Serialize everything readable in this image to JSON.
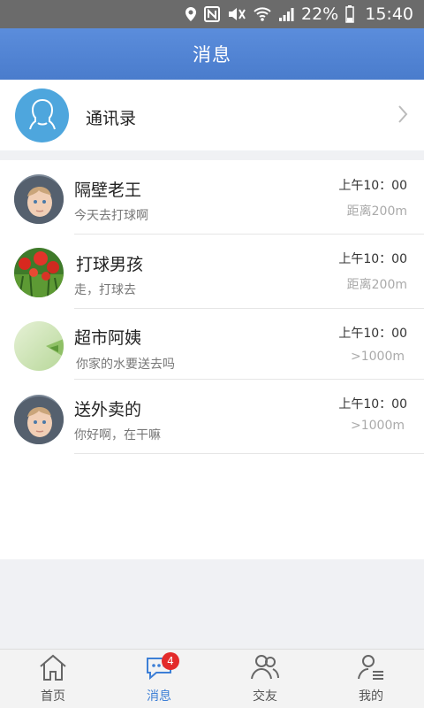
{
  "status_bar": {
    "battery": "22%",
    "time": "15:40"
  },
  "header": {
    "title": "消息"
  },
  "contacts": {
    "label": "通讯录",
    "icon": "person-outline-icon",
    "chevron": "chevron-right-icon"
  },
  "messages": [
    {
      "name": "隔壁老王",
      "preview": "今天去打球啊",
      "time": "上午10：00",
      "distance": "距离200m",
      "avatar": "child-photo"
    },
    {
      "name": "打球男孩",
      "preview": "走，打球去",
      "time": "上午10：00",
      "distance": "距离200m",
      "avatar": "red-flowers-photo"
    },
    {
      "name": "超市阿姨",
      "preview": "你家的水要送去吗",
      "time": "上午10：00",
      "distance": ">1000m",
      "avatar": "green-abstract-photo"
    },
    {
      "name": "送外卖的",
      "preview": "你好啊，在干嘛",
      "time": "上午10：00",
      "distance": ">1000m",
      "avatar": "child-photo"
    }
  ],
  "nav": {
    "items": [
      {
        "label": "首页",
        "icon": "home-icon"
      },
      {
        "label": "消息",
        "icon": "chat-bubble-icon",
        "badge": "4",
        "active": true
      },
      {
        "label": "交友",
        "icon": "friends-icon"
      },
      {
        "label": "我的",
        "icon": "profile-icon"
      }
    ]
  },
  "colors": {
    "header": "#4f83d3",
    "accent": "#3d7fd6",
    "badge": "#e32b2b",
    "contacts_avatar": "#4ea6dd"
  }
}
